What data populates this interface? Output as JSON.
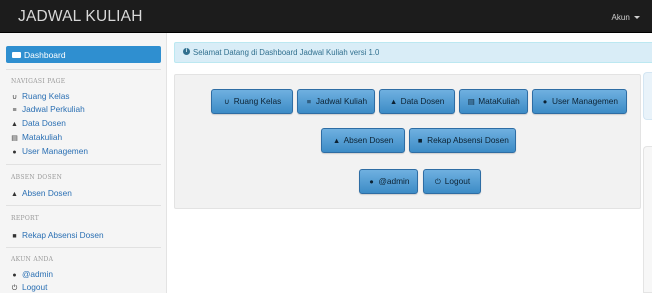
{
  "header": {
    "brand": "JADWAL KULIAH",
    "account_label": "Akun"
  },
  "sidebar": {
    "active": {
      "label": "Dashboard",
      "icon": "folder-open-icon"
    },
    "sections": [
      {
        "title": "NAVIGASI PAGE",
        "items": [
          {
            "label": "Ruang Kelas",
            "icon": "magnet-icon"
          },
          {
            "label": "Jadwal Perkuliah",
            "icon": "list-icon"
          },
          {
            "label": "Data Dosen",
            "icon": "education-icon"
          },
          {
            "label": "Matakuliah",
            "icon": "table-icon"
          },
          {
            "label": "User Managemen",
            "icon": "user-icon"
          }
        ]
      },
      {
        "title": "ABSEN DOSEN",
        "items": [
          {
            "label": "Absen Dosen",
            "icon": "bell-icon"
          }
        ]
      },
      {
        "title": "REPORT",
        "items": [
          {
            "label": "Rekap Absensi Dosen",
            "icon": "file-icon"
          }
        ]
      },
      {
        "title": "AKUN ANDA",
        "items": [
          {
            "label": "@admin",
            "icon": "user-icon"
          },
          {
            "label": "Logout",
            "icon": "power-icon"
          }
        ]
      }
    ]
  },
  "alert": {
    "text": "Selamat Datang di Dashboard Jadwal Kuliah versi 1.0",
    "icon": "info-icon"
  },
  "dashboard_buttons": [
    {
      "label": "Ruang Kelas",
      "icon": "magnet-icon"
    },
    {
      "label": "Jadwal Kuliah",
      "icon": "list-icon"
    },
    {
      "label": "Data Dosen",
      "icon": "education-icon"
    },
    {
      "label": "MataKuliah",
      "icon": "table-icon"
    },
    {
      "label": "User Managemen",
      "icon": "user-icon"
    },
    {
      "label": "Absen Dosen",
      "icon": "bell-icon"
    },
    {
      "label": "Rekap Absensi Dosen",
      "icon": "file-icon"
    },
    {
      "label": "@admin",
      "icon": "user-icon"
    },
    {
      "label": "Logout",
      "icon": "power-icon"
    }
  ],
  "colors": {
    "topbar": "#1c1c1c",
    "accent": "#2f8fd0",
    "alert_bg": "#d9edf7",
    "button": "#3d8cc6"
  }
}
